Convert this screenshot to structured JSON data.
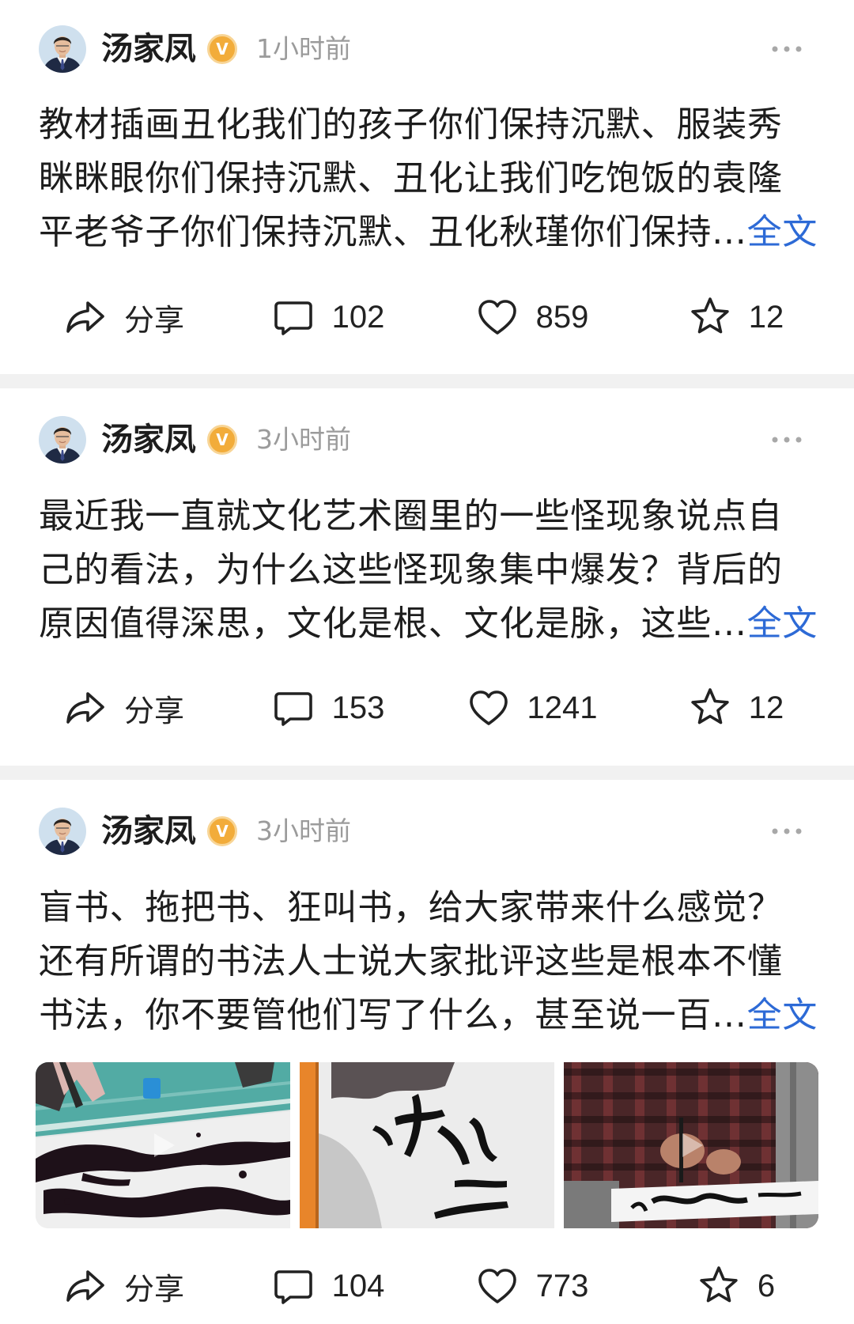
{
  "colors": {
    "text": "#1d1d1d",
    "secondary_text": "#9b9b9b",
    "link": "#2d6ad6",
    "verified_badge": "#f2ac3a",
    "separator": "#f1f1f1",
    "icon": "#222222"
  },
  "verified_badge": {
    "letter": "V"
  },
  "icons": {
    "more": "more-dots-icon",
    "share": "share-icon",
    "comment": "comment-icon",
    "like": "like-heart-icon",
    "favorite": "favorite-star-icon",
    "video": "video-play-icon"
  },
  "posts": [
    {
      "author": "汤家凤",
      "time": "1小时前",
      "text_lines": [
        "教材插画丑化我们的孩子你们保持沉默、服装秀",
        "眯眯眼你们保持沉默、丑化让我们吃饱饭的袁隆",
        "平老爷子你们保持沉默、丑化秋瑾你们保持..."
      ],
      "more_label": "全文",
      "actions": {
        "share": "分享",
        "comments": "102",
        "likes": "859",
        "favorites": "12"
      }
    },
    {
      "author": "汤家凤",
      "time": "3小时前",
      "text_lines": [
        "最近我一直就文化艺术圈里的一些怪现象说点自",
        "己的看法，为什么这些怪现象集中爆发？背后的",
        "原因值得深思，文化是根、文化是脉，这些..."
      ],
      "more_label": "全文",
      "actions": {
        "share": "分享",
        "comments": "153",
        "likes": "1241",
        "favorites": "12"
      }
    },
    {
      "author": "汤家凤",
      "time": "3小时前",
      "text_lines": [
        "盲书、拖把书、狂叫书，给大家带来什么感觉？",
        "还有所谓的书法人士说大家批评这些是根本不懂",
        "书法，你不要管他们写了什么，甚至说一百..."
      ],
      "more_label": "全文",
      "actions": {
        "share": "分享",
        "comments": "104",
        "likes": "773",
        "favorites": "6"
      }
    }
  ]
}
